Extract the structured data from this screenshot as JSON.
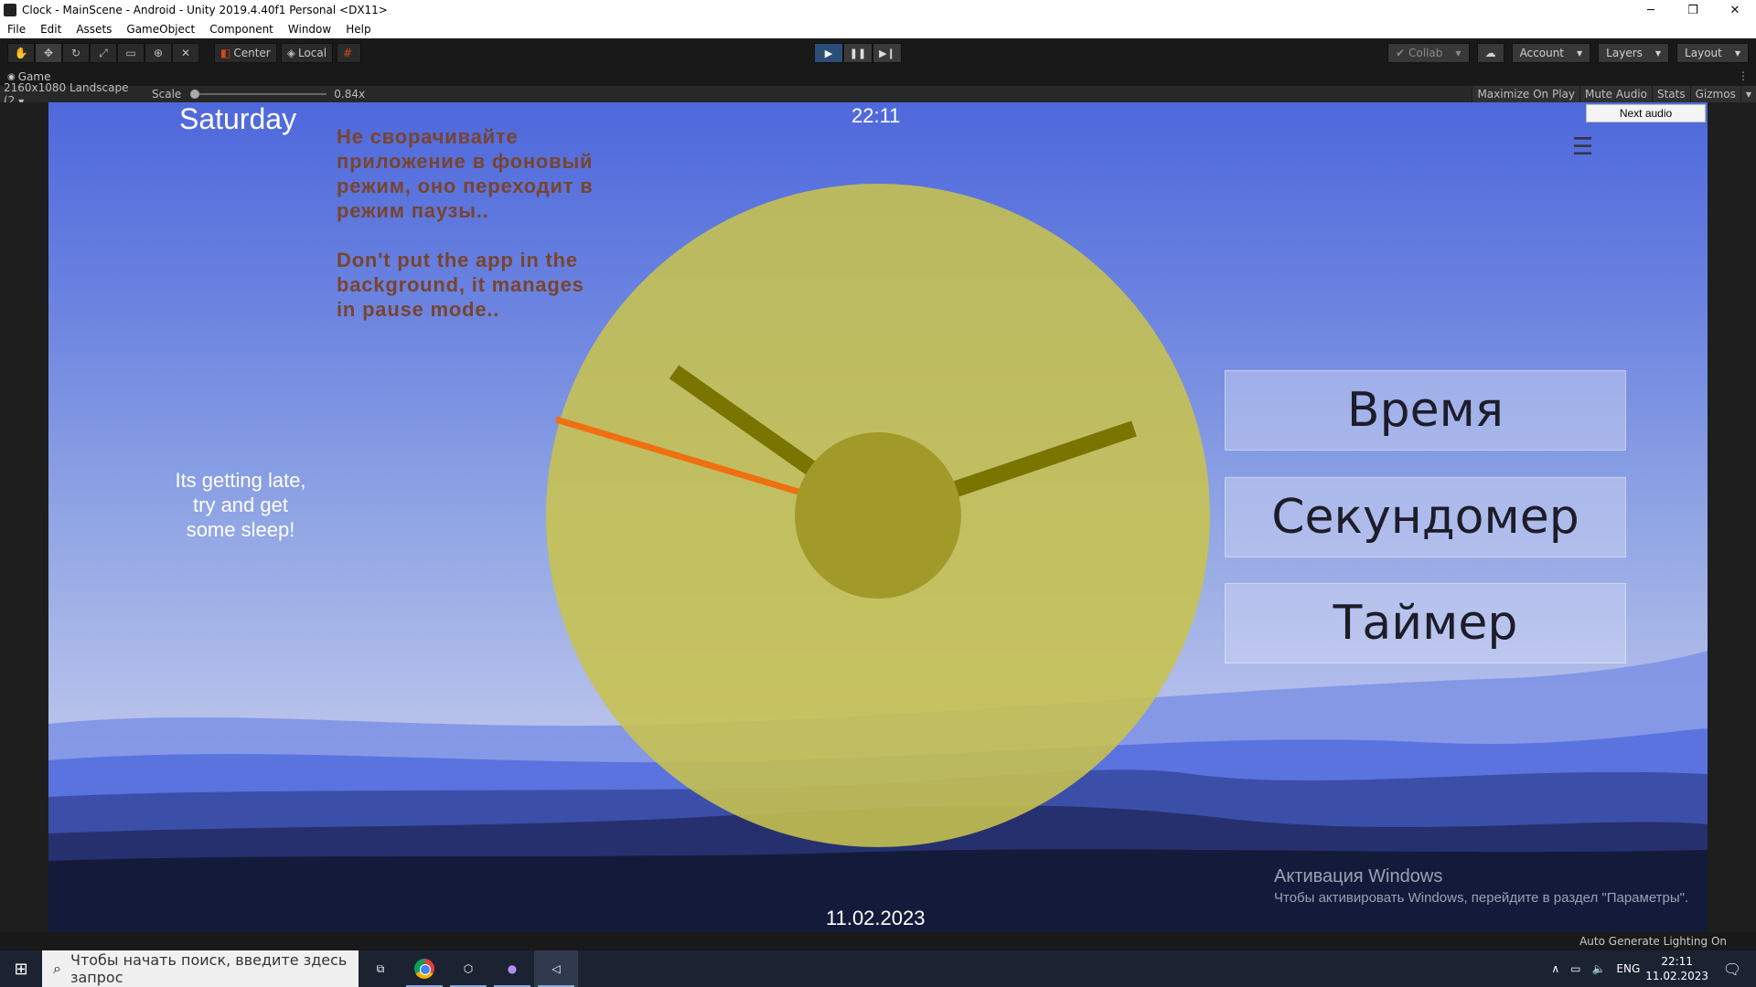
{
  "window": {
    "title": "Clock - MainScene - Android - Unity 2019.4.40f1 Personal <DX11>",
    "controls": [
      "─",
      "❐",
      "✕"
    ]
  },
  "menu": [
    "File",
    "Edit",
    "Assets",
    "GameObject",
    "Component",
    "Window",
    "Help"
  ],
  "toolbar": {
    "tools": [
      "hand-icon",
      "move-icon",
      "rotate-icon",
      "scale-icon",
      "rect-icon",
      "transform-icon",
      "custom-tool-icon"
    ],
    "pivot_label": "Center",
    "space_label": "Local",
    "collab_label": "Collab",
    "account_label": "Account",
    "layers_label": "Layers",
    "layout_label": "Layout"
  },
  "game_tab": {
    "label": "Game"
  },
  "game_bar": {
    "resolution": "2160x1080 Landscape (2",
    "scale_label": "Scale",
    "scale_value": "0.84x",
    "scale_fraction": 0.0,
    "maximize": "Maximize On Play",
    "mute": "Mute Audio",
    "stats": "Stats",
    "gizmos": "Gizmos"
  },
  "game": {
    "day": "Saturday",
    "time": "22:11",
    "warning": "Не сворачивайте\nприложение в фоновый\nрежим, оно переходит в\nрежим паузы..\n\nDon't put the app in the\nbackground, it manages\nin pause mode..",
    "sleep_message": "Its getting late,\ntry and get\nsome sleep!",
    "date": "11.02.2023",
    "next_audio": "Next audio",
    "menu_icon": "☰",
    "modes": [
      "Время",
      "Секундомер",
      "Таймер"
    ],
    "clock_colors": {
      "face": "#c8c34e",
      "center": "#a19a2a",
      "hands": "#7a7400",
      "second_hand": "#ef6f12"
    },
    "activation_title": "Активация Windows",
    "activation_text": "Чтобы активировать Windows, перейдите в раздел \"Параметры\"."
  },
  "statusbar": {
    "text": "Auto Generate Lighting On"
  },
  "taskbar": {
    "search_placeholder": "Чтобы начать поиск, введите здесь запрос",
    "language": "ENG",
    "time": "22:11",
    "date": "11.02.2023"
  }
}
